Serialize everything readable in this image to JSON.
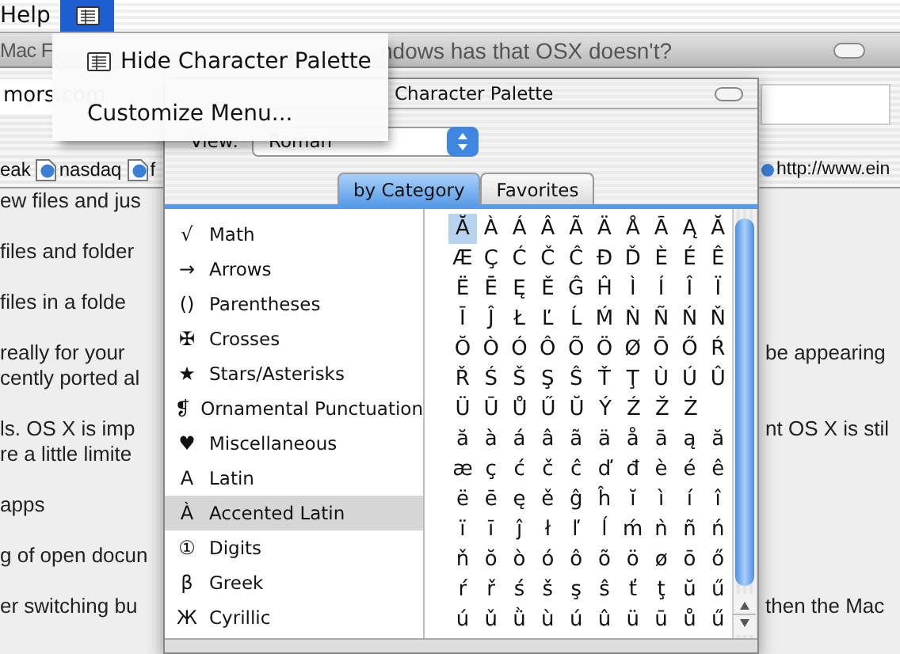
{
  "menubar": {
    "items": [
      {
        "kind": "text",
        "label": "Help",
        "selected": false
      },
      {
        "kind": "palette-icon",
        "selected": true
      }
    ]
  },
  "menu": {
    "items": [
      {
        "label": "Hide Character Palette",
        "icon": true
      },
      {
        "label": "Customize Menu...",
        "icon": false
      }
    ]
  },
  "browser": {
    "title_left": "Mac F",
    "title_right": "ndows has that OSX doesn't?",
    "address": "mors.com",
    "bookmarks": [
      {
        "label": "eak",
        "icon": false
      },
      {
        "label": "nasdaq",
        "icon": true
      },
      {
        "label": "f",
        "icon": true
      }
    ],
    "bookmark_right": "http://www.ein",
    "content": [
      {
        "left": [
          "ew files and jus"
        ]
      },
      {
        "left": [
          "files and folder"
        ]
      },
      {
        "left": [
          "files in a folde"
        ]
      },
      {
        "left": [
          "really for your",
          "cently ported al"
        ],
        "right": "be appearing"
      },
      {
        "left": [
          "ls. OS X is imp",
          "re a little limite"
        ],
        "right": "nt OS X is stil"
      },
      {
        "left": [
          "apps"
        ]
      },
      {
        "left": [
          "g of open docun"
        ]
      },
      {
        "left": [
          "er switching bu"
        ],
        "right": "then the Mac"
      }
    ]
  },
  "palette": {
    "title": "Character Palette",
    "view_label": "View:",
    "view_value": "Roman",
    "tabs": [
      {
        "label": "by Category",
        "selected": true
      },
      {
        "label": "Favorites",
        "selected": false
      }
    ],
    "categories": [
      {
        "symbol": "√",
        "label": "Math",
        "selected": false
      },
      {
        "symbol": "→",
        "label": "Arrows",
        "selected": false
      },
      {
        "symbol": "()",
        "label": "Parentheses",
        "selected": false
      },
      {
        "symbol": "✠",
        "label": "Crosses",
        "selected": false
      },
      {
        "symbol": "★",
        "label": "Stars/Asterisks",
        "selected": false
      },
      {
        "symbol": "❡",
        "label": "Ornamental Punctuation",
        "selected": false
      },
      {
        "symbol": "♥",
        "label": "Miscellaneous",
        "selected": false
      },
      {
        "symbol": "A",
        "label": "Latin",
        "selected": false
      },
      {
        "symbol": "À",
        "label": "Accented Latin",
        "selected": true
      },
      {
        "symbol": "①",
        "label": "Digits",
        "selected": false
      },
      {
        "symbol": "β",
        "label": "Greek",
        "selected": false
      },
      {
        "symbol": "Ж",
        "label": "Cyrillic",
        "selected": false
      }
    ],
    "grid": [
      [
        {
          "c": "Ă",
          "selected": true
        },
        {
          "c": "À",
          "selected": false
        },
        {
          "c": "Á",
          "selected": false
        },
        {
          "c": "Â",
          "selected": false
        },
        {
          "c": "Ã",
          "selected": false
        },
        {
          "c": "Ä",
          "selected": false
        },
        {
          "c": "Å",
          "selected": false
        },
        {
          "c": "Ā",
          "selected": false
        },
        {
          "c": "Ą",
          "selected": false
        },
        {
          "c": "Ă",
          "selected": false
        }
      ],
      [
        {
          "c": "Æ",
          "selected": false
        },
        {
          "c": "Ç",
          "selected": false
        },
        {
          "c": "Ć",
          "selected": false
        },
        {
          "c": "Č",
          "selected": false
        },
        {
          "c": "Ĉ",
          "selected": false
        },
        {
          "c": "Đ",
          "selected": false
        },
        {
          "c": "Ď",
          "selected": false
        },
        {
          "c": "È",
          "selected": false
        },
        {
          "c": "É",
          "selected": false
        },
        {
          "c": "Ê",
          "selected": false
        }
      ],
      [
        {
          "c": "Ë",
          "selected": false
        },
        {
          "c": "Ē",
          "selected": false
        },
        {
          "c": "Ę",
          "selected": false
        },
        {
          "c": "Ě",
          "selected": false
        },
        {
          "c": "Ĝ",
          "selected": false
        },
        {
          "c": "Ĥ",
          "selected": false
        },
        {
          "c": "Ì",
          "selected": false
        },
        {
          "c": "Í",
          "selected": false
        },
        {
          "c": "Î",
          "selected": false
        },
        {
          "c": "Ï",
          "selected": false
        }
      ],
      [
        {
          "c": "Ī",
          "selected": false
        },
        {
          "c": "Ĵ",
          "selected": false
        },
        {
          "c": "Ł",
          "selected": false
        },
        {
          "c": "Ľ",
          "selected": false
        },
        {
          "c": "Ĺ",
          "selected": false
        },
        {
          "c": "Ḿ",
          "selected": false
        },
        {
          "c": "Ǹ",
          "selected": false
        },
        {
          "c": "Ñ",
          "selected": false
        },
        {
          "c": "Ń",
          "selected": false
        },
        {
          "c": "Ň",
          "selected": false
        }
      ],
      [
        {
          "c": "Ŏ",
          "selected": false
        },
        {
          "c": "Ò",
          "selected": false
        },
        {
          "c": "Ó",
          "selected": false
        },
        {
          "c": "Ô",
          "selected": false
        },
        {
          "c": "Õ",
          "selected": false
        },
        {
          "c": "Ö",
          "selected": false
        },
        {
          "c": "Ø",
          "selected": false
        },
        {
          "c": "Ō",
          "selected": false
        },
        {
          "c": "Ő",
          "selected": false
        },
        {
          "c": "Ŕ",
          "selected": false
        }
      ],
      [
        {
          "c": "Ř",
          "selected": false
        },
        {
          "c": "Ś",
          "selected": false
        },
        {
          "c": "Š",
          "selected": false
        },
        {
          "c": "Ş",
          "selected": false
        },
        {
          "c": "Ŝ",
          "selected": false
        },
        {
          "c": "Ť",
          "selected": false
        },
        {
          "c": "Ţ",
          "selected": false
        },
        {
          "c": "Ù",
          "selected": false
        },
        {
          "c": "Ú",
          "selected": false
        },
        {
          "c": "Û",
          "selected": false
        }
      ],
      [
        {
          "c": "Ü",
          "selected": false
        },
        {
          "c": "Ū",
          "selected": false
        },
        {
          "c": "Ů",
          "selected": false
        },
        {
          "c": "Ű",
          "selected": false
        },
        {
          "c": "Ŭ",
          "selected": false
        },
        {
          "c": "Ý",
          "selected": false
        },
        {
          "c": "Ź",
          "selected": false
        },
        {
          "c": "Ž",
          "selected": false
        },
        {
          "c": "Ż",
          "selected": false
        }
      ],
      [
        {
          "c": "ă",
          "selected": false
        },
        {
          "c": "à",
          "selected": false
        },
        {
          "c": "á",
          "selected": false
        },
        {
          "c": "â",
          "selected": false
        },
        {
          "c": "ã",
          "selected": false
        },
        {
          "c": "ä",
          "selected": false
        },
        {
          "c": "å",
          "selected": false
        },
        {
          "c": "ā",
          "selected": false
        },
        {
          "c": "ą",
          "selected": false
        },
        {
          "c": "ă",
          "selected": false
        }
      ],
      [
        {
          "c": "æ",
          "selected": false
        },
        {
          "c": "ç",
          "selected": false
        },
        {
          "c": "ć",
          "selected": false
        },
        {
          "c": "č",
          "selected": false
        },
        {
          "c": "ĉ",
          "selected": false
        },
        {
          "c": "ď",
          "selected": false
        },
        {
          "c": "đ",
          "selected": false
        },
        {
          "c": "è",
          "selected": false
        },
        {
          "c": "é",
          "selected": false
        },
        {
          "c": "ê",
          "selected": false
        }
      ],
      [
        {
          "c": "ë",
          "selected": false
        },
        {
          "c": "ē",
          "selected": false
        },
        {
          "c": "ę",
          "selected": false
        },
        {
          "c": "ě",
          "selected": false
        },
        {
          "c": "ĝ",
          "selected": false
        },
        {
          "c": "ĥ",
          "selected": false
        },
        {
          "c": "ĭ",
          "selected": false
        },
        {
          "c": "ì",
          "selected": false
        },
        {
          "c": "í",
          "selected": false
        },
        {
          "c": "î",
          "selected": false
        }
      ],
      [
        {
          "c": "ï",
          "selected": false
        },
        {
          "c": "ī",
          "selected": false
        },
        {
          "c": "ĵ",
          "selected": false
        },
        {
          "c": "ł",
          "selected": false
        },
        {
          "c": "ľ",
          "selected": false
        },
        {
          "c": "ĺ",
          "selected": false
        },
        {
          "c": "ḿ",
          "selected": false
        },
        {
          "c": "ǹ",
          "selected": false
        },
        {
          "c": "ñ",
          "selected": false
        },
        {
          "c": "ń",
          "selected": false
        }
      ],
      [
        {
          "c": "ň",
          "selected": false
        },
        {
          "c": "ŏ",
          "selected": false
        },
        {
          "c": "ò",
          "selected": false
        },
        {
          "c": "ó",
          "selected": false
        },
        {
          "c": "ô",
          "selected": false
        },
        {
          "c": "õ",
          "selected": false
        },
        {
          "c": "ö",
          "selected": false
        },
        {
          "c": "ø",
          "selected": false
        },
        {
          "c": "ō",
          "selected": false
        },
        {
          "c": "ő",
          "selected": false
        }
      ],
      [
        {
          "c": "ŕ",
          "selected": false
        },
        {
          "c": "ř",
          "selected": false
        },
        {
          "c": "ś",
          "selected": false
        },
        {
          "c": "š",
          "selected": false
        },
        {
          "c": "ş",
          "selected": false
        },
        {
          "c": "ŝ",
          "selected": false
        },
        {
          "c": "ť",
          "selected": false
        },
        {
          "c": "ţ",
          "selected": false
        },
        {
          "c": "ŭ",
          "selected": false
        },
        {
          "c": "ű",
          "selected": false
        }
      ],
      [
        {
          "c": "ú",
          "selected": false
        },
        {
          "c": "ǔ",
          "selected": false
        },
        {
          "c": "ǜ",
          "selected": false
        },
        {
          "c": "ù",
          "selected": false
        },
        {
          "c": "ú",
          "selected": false
        },
        {
          "c": "û",
          "selected": false
        },
        {
          "c": "ü",
          "selected": false
        },
        {
          "c": "ū",
          "selected": false
        },
        {
          "c": "ů",
          "selected": false
        },
        {
          "c": "ű",
          "selected": false
        }
      ]
    ]
  }
}
